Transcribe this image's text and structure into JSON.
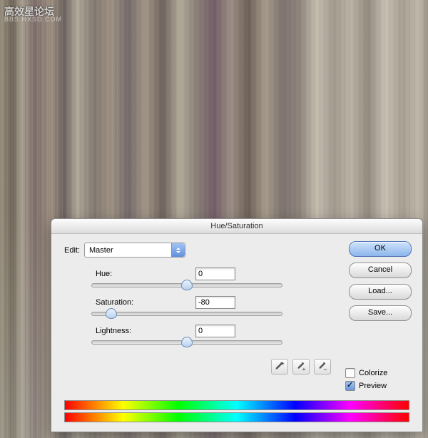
{
  "watermark": {
    "title": "高效星论坛",
    "sub": "BBS.HXSD.COM"
  },
  "dialog": {
    "title": "Hue/Saturation",
    "editLabel": "Edit:",
    "editValue": "Master",
    "sliders": {
      "hue": {
        "label": "Hue:",
        "value": "0",
        "pct": 50
      },
      "saturation": {
        "label": "Saturation:",
        "value": "-80",
        "pct": 10
      },
      "lightness": {
        "label": "Lightness:",
        "value": "0",
        "pct": 50
      }
    },
    "buttons": {
      "ok": "OK",
      "cancel": "Cancel",
      "load": "Load...",
      "save": "Save..."
    },
    "colorize": {
      "label": "Colorize",
      "checked": false
    },
    "preview": {
      "label": "Preview",
      "checked": true
    },
    "tools": {
      "eye1": "eyedropper-icon",
      "eye2": "eyedropper-plus-icon",
      "eye3": "eyedropper-minus-icon"
    }
  }
}
